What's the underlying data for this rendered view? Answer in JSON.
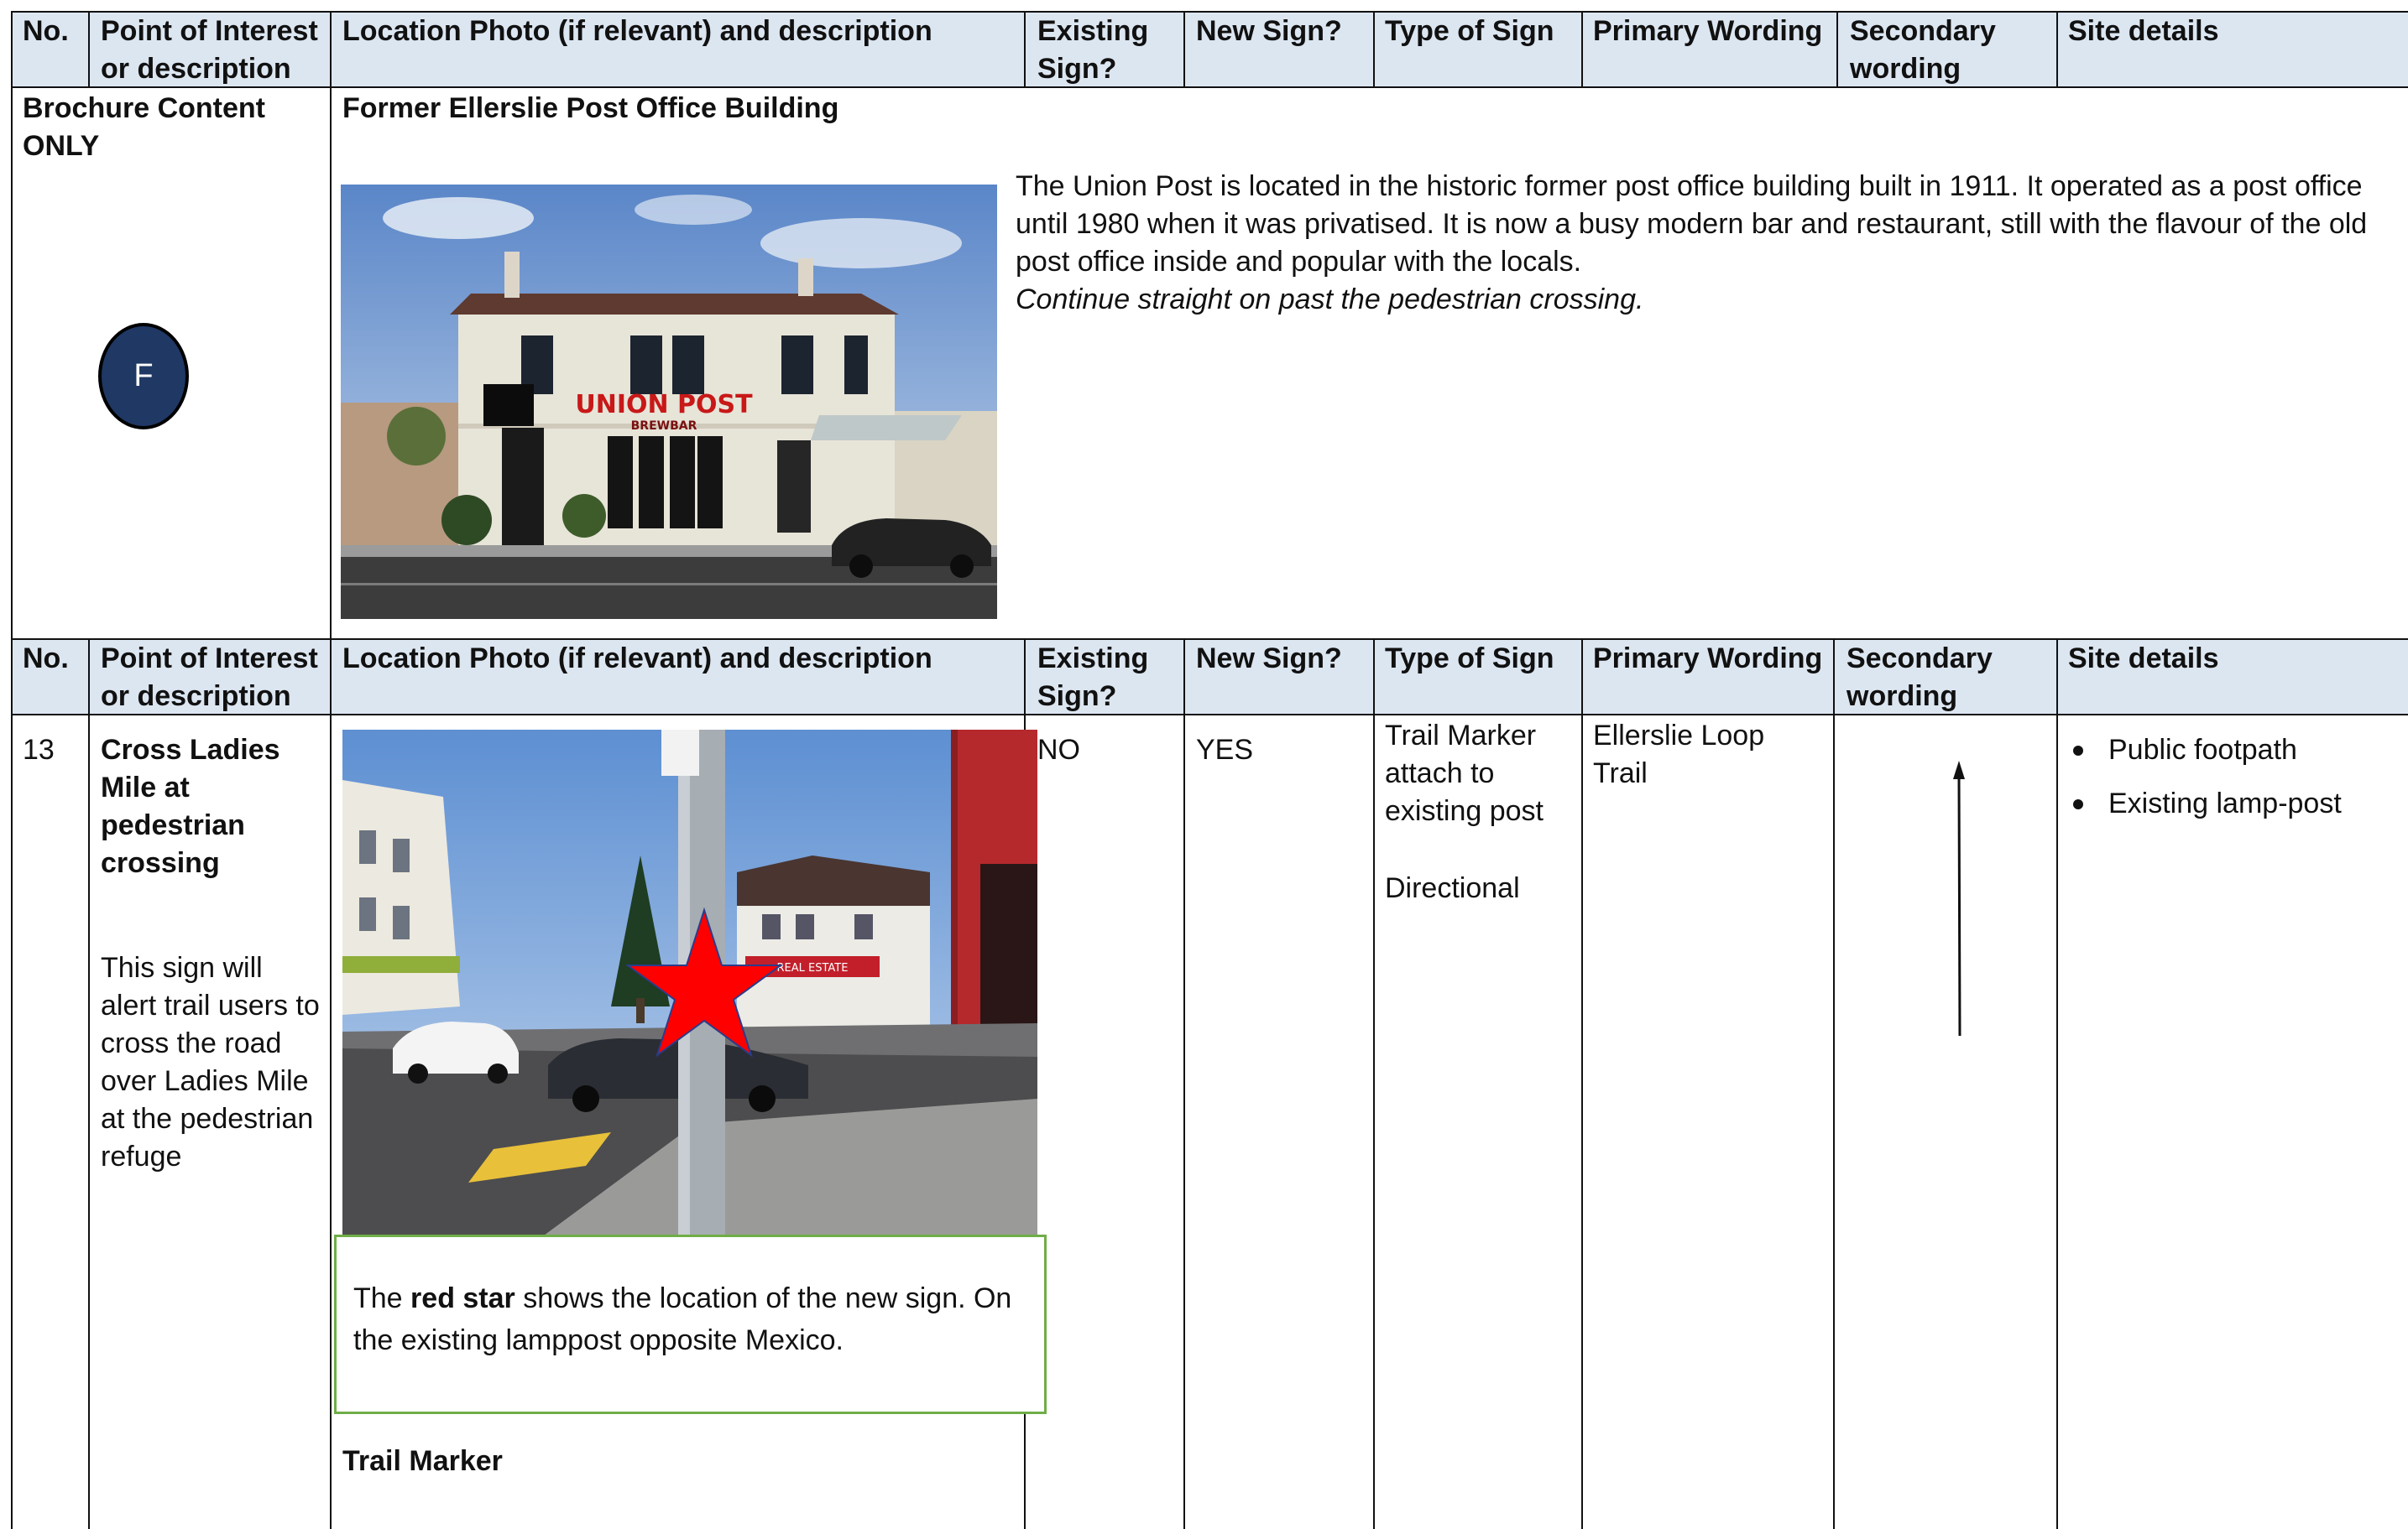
{
  "table_header": {
    "no": "No.",
    "point_of_interest": "Point of Interest or description",
    "location_photo": "Location Photo (if relevant) and description",
    "existing_sign": "Existing Sign?",
    "new_sign": "New Sign?",
    "type_of_sign": "Type of Sign",
    "primary_wording": "Primary Wording",
    "secondary_wording": "Secondary wording",
    "site_details": "Site details"
  },
  "brochure": {
    "label": "Brochure Content ONLY",
    "marker_letter": "F",
    "title": "Former Ellerslie Post Office Building",
    "description": "The Union Post is located in the historic former post office building built in 1911. It operated as a post office until 1980 when it was privatised. It is now a busy modern bar and restaurant, still with the flavour of the old post office inside and popular with the locals.",
    "direction": "Continue straight on past the pedestrian crossing.",
    "photo_sign_text": "UNION POST",
    "photo_sign_subtext": "BREWBAR"
  },
  "row13": {
    "no": "13",
    "poi_title": "Cross Ladies Mile at pedestrian crossing",
    "poi_desc": "This sign will alert trail users to cross the road over Ladies Mile at the pedestrian refuge",
    "caption_pre": "The ",
    "caption_bold": "red star",
    "caption_post": " shows the location of the new sign. On the existing lamppost opposite Mexico.",
    "trail_marker_label": "Trail Marker",
    "existing_sign": "NO",
    "new_sign": "YES",
    "type_of_sign_1": "Trail Marker attach to existing post",
    "type_of_sign_2": "Directional",
    "primary_wording": "Ellerslie Loop Trail",
    "site_details": [
      "Public footpath",
      "Existing lamp-post"
    ],
    "photo_sign_text": "REAL ESTATE"
  },
  "colors": {
    "header_bg": "#dce6f1",
    "marker_fill": "#1f3864",
    "star": "#ff0000",
    "caption_border": "#70ad47"
  }
}
